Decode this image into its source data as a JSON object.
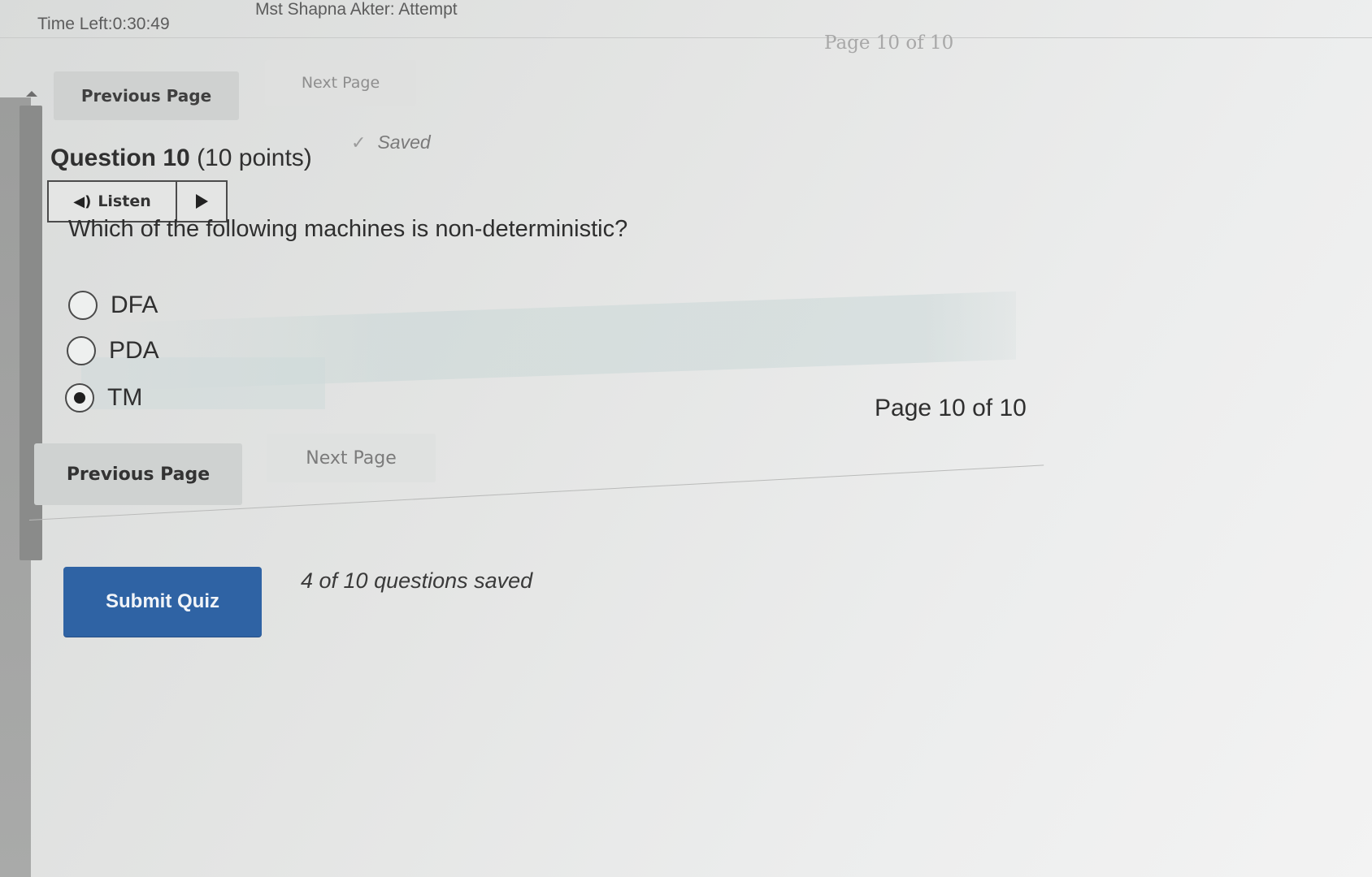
{
  "header": {
    "timer": "Time Left:0:30:49",
    "user": "Mst Shapna Akter: Attempt",
    "page_indicator": "Page 10 of 10"
  },
  "nav_top": {
    "previous_label": "Previous Page",
    "next_label": "Next Page"
  },
  "question": {
    "label": "Question 10",
    "points": "(10 points)",
    "saved_status": "Saved",
    "listen_label": "Listen",
    "text": "Which of the following machines is non-deterministic?",
    "options": [
      {
        "label": "DFA",
        "selected": false
      },
      {
        "label": "PDA",
        "selected": false
      },
      {
        "label": "TM",
        "selected": true
      }
    ]
  },
  "nav_bottom": {
    "page_indicator": "Page 10 of 10",
    "previous_label": "Previous Page",
    "next_label": "Next Page"
  },
  "footer": {
    "submit_label": "Submit Quiz",
    "saved_count": "4 of 10 questions saved"
  },
  "colors": {
    "submit_button": "#2f63a4",
    "background": "#e4e5e4"
  },
  "icons": {
    "saved": "check-icon",
    "listen": "speaker-icon",
    "play": "play-icon"
  }
}
